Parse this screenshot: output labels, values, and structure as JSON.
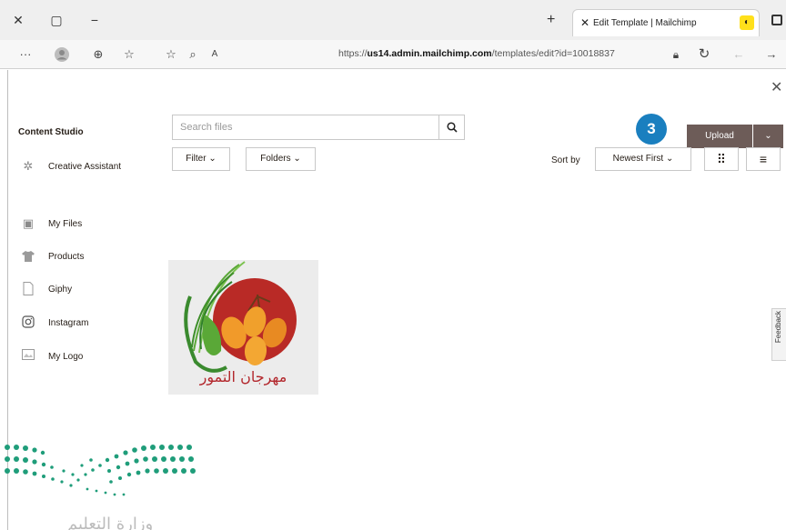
{
  "browser": {
    "tab_title": "Edit Template | Mailchimp",
    "tab_favicon": "mailchimp-icon",
    "url_prefix": "https://",
    "url_domain": "us14.admin.mailchimp.com",
    "url_path": "/templates/edit?id=10018837"
  },
  "studio": {
    "title": "Content Studio",
    "search_placeholder": "Search files",
    "upload_label": "Upload",
    "step_number": "3",
    "step_color": "#1a7fbf",
    "upload_color": "#6d5c58",
    "filter_label": "Filter",
    "folders_label": "Folders",
    "sort_label": "Sort by",
    "sort_value": "Newest First",
    "feedback_label": "Feedback",
    "sidebar": [
      {
        "label": "Creative Assistant",
        "icon": "sparkle-icon"
      },
      {
        "label": "My Files",
        "icon": "image-icon"
      },
      {
        "label": "Products",
        "icon": "shirt-icon"
      },
      {
        "label": "Giphy",
        "icon": "file-icon"
      },
      {
        "label": "Instagram",
        "icon": "instagram-icon"
      },
      {
        "label": "My Logo",
        "icon": "logo-icon"
      }
    ],
    "files": [
      {
        "caption": "مهرجان التمور"
      }
    ]
  },
  "overlay": {
    "ministry_text": "وزارة التعليم"
  }
}
